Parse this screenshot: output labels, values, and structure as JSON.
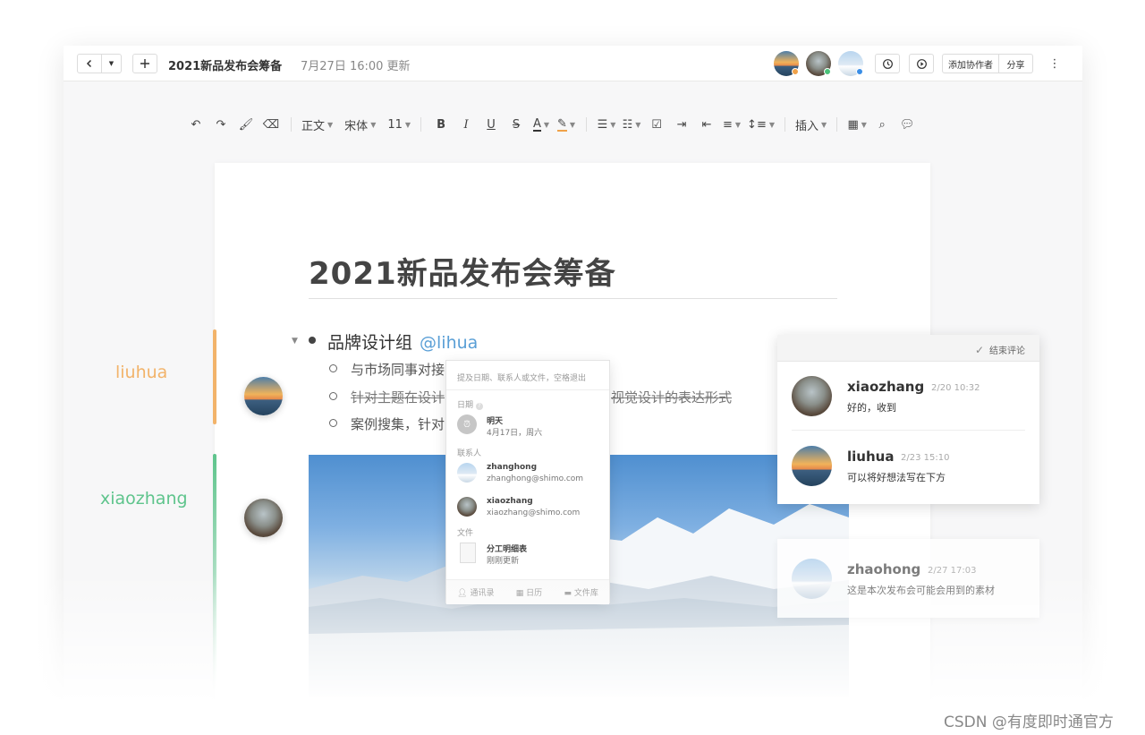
{
  "topbar": {
    "back_icon": "chevron-left-icon",
    "dropdown_icon": "caret-down-icon",
    "new_icon": "plus-icon",
    "doc_title": "2021新品发布会筹备",
    "updated": "7月27日 16:00 更新",
    "history_icon": "history-icon",
    "play_icon": "play-icon",
    "add_collaborator": "添加协作者",
    "share": "分享",
    "more_icon": "more-vertical-icon",
    "presence_colors": [
      "#f0a24a",
      "#49c27a",
      "#3a8ee6"
    ]
  },
  "toolbar": {
    "paragraph": "正文",
    "font": "宋体",
    "size": "11",
    "insert": "插入"
  },
  "document": {
    "title": "2021新品发布会筹备",
    "heading_item": "品牌设计组",
    "mention": "@lihua",
    "sub_items": [
      "与市场同事对接",
      "针对主题在设计",
      "视觉设计的表达形式",
      "案例搜集，针对"
    ]
  },
  "users": {
    "liuhua": {
      "label": "liuhua",
      "color": "#f2b36a"
    },
    "xiaozhang": {
      "label": "xiaozhang",
      "color": "#5ec48c"
    }
  },
  "popover": {
    "placeholder": "提及日期、联系人或文件，空格退出",
    "date_section": "日期",
    "date_title": "明天",
    "date_sub": "4月17日，周六",
    "contacts_section": "联系人",
    "contacts": [
      {
        "name": "zhanghong",
        "email": "zhanghong@shimo.com"
      },
      {
        "name": "xiaozhang",
        "email": "xiaozhang@shimo.com"
      }
    ],
    "files_section": "文件",
    "file_title": "分工明细表",
    "file_sub": "刚刚更新",
    "footer": [
      "通讯录",
      "日历",
      "文件库"
    ]
  },
  "comments": {
    "end_label": "结束评论",
    "items": [
      {
        "name": "xiaozhang",
        "time": "2/20 10:32",
        "text": "好的，收到"
      },
      {
        "name": "liuhua",
        "time": "2/23 15:10",
        "text": "可以将好想法写在下方"
      },
      {
        "name": "zhaohong",
        "time": "2/27 17:03",
        "text": "这是本次发布会可能会用到的素材"
      }
    ]
  },
  "watermark": "CSDN @有度即时通官方"
}
